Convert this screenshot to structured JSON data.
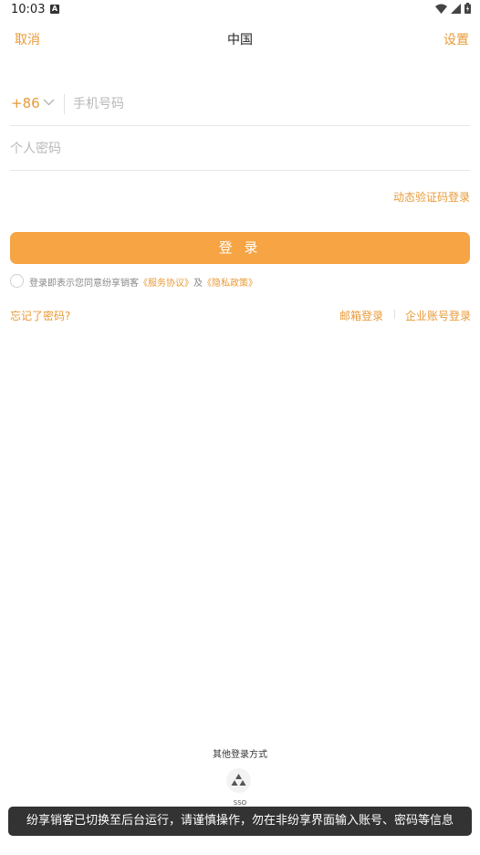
{
  "status_bar": {
    "time": "10:03",
    "notif_letter": "A"
  },
  "nav": {
    "cancel": "取消",
    "title": "中国",
    "settings": "设置"
  },
  "login_form": {
    "country_code": "+86",
    "phone_placeholder": "手机号码",
    "password_placeholder": "个人密码",
    "dynamic_code_login": "动态验证码登录",
    "login_button": "登 录",
    "agreement": {
      "prefix": "登录即表示您同意纷享销客",
      "service": "《服务协议》",
      "conj": "及",
      "privacy": "《隐私政策》"
    },
    "forgot_password": "忘记了密码?",
    "email_login": "邮箱登录",
    "corp_login": "企业账号登录"
  },
  "other_login": {
    "title": "其他登录方式",
    "sso_label": "SSO"
  },
  "toast": {
    "text": "纷享销客已切换至后台运行，请谨慎操作，勿在非纷享界面输入账号、密码等信息"
  },
  "colors": {
    "accent": "#e99a38",
    "button": "#f6a444",
    "toast_bg": "#333333"
  }
}
